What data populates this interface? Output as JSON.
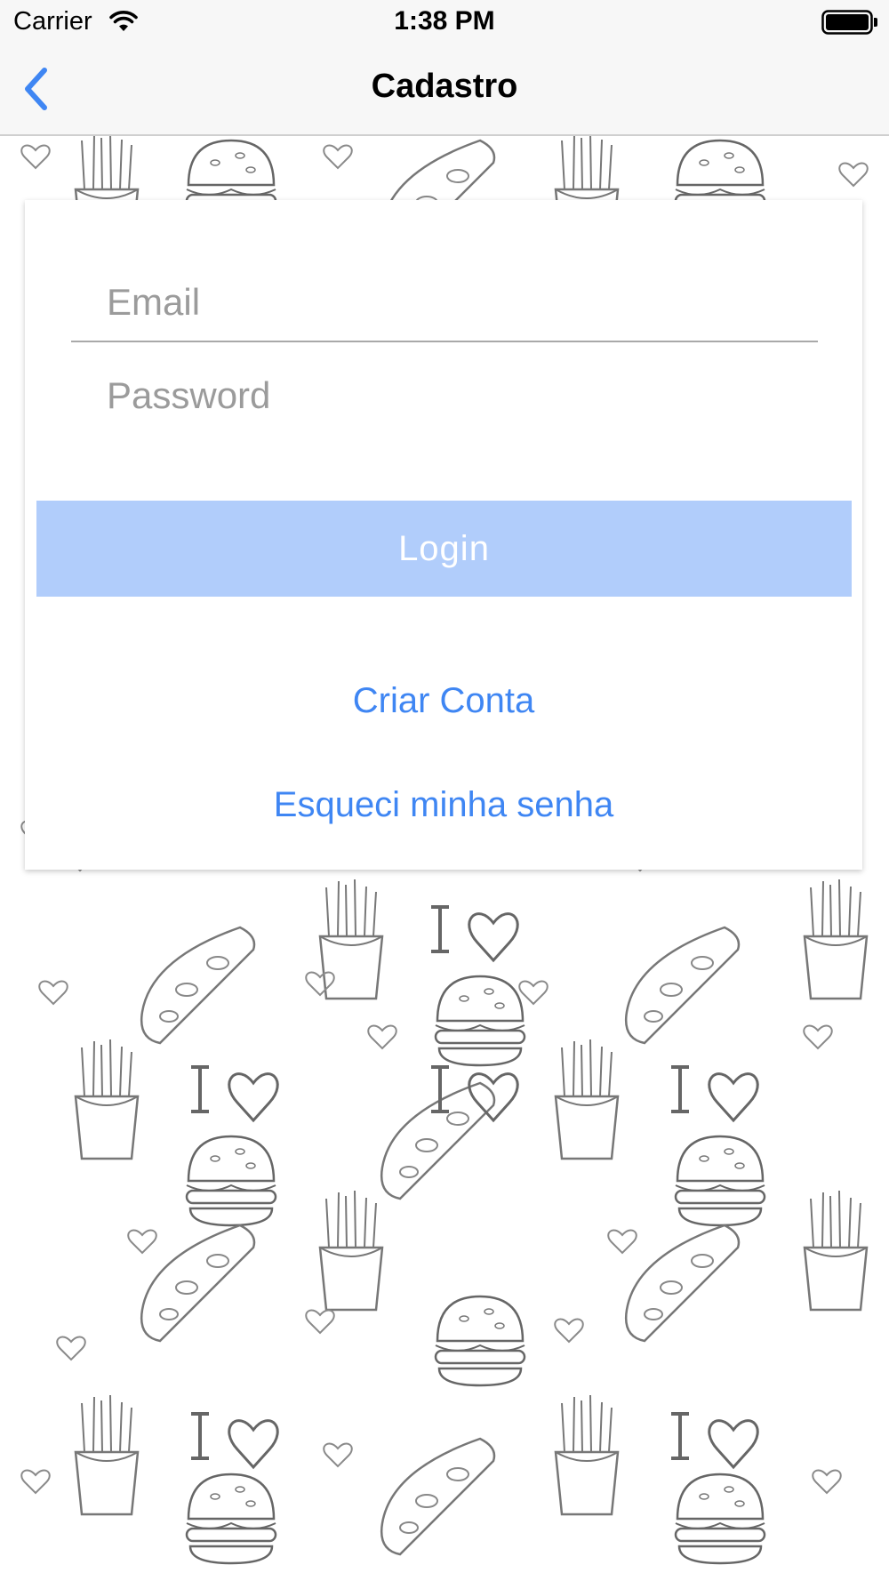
{
  "status_bar": {
    "carrier": "Carrier",
    "time": "1:38 PM",
    "wifi_icon": "wifi-icon",
    "battery_icon": "battery-icon"
  },
  "nav": {
    "title": "Cadastro",
    "back_icon": "chevron-left-icon"
  },
  "background": {
    "pattern": "food-doodle-pattern (fries, burgers, pizza, hearts, I love)"
  },
  "form": {
    "email_placeholder": "Email",
    "email_value": "",
    "password_placeholder": "Password",
    "password_value": "",
    "login_label": "Login",
    "create_account_label": "Criar Conta",
    "forgot_password_label": "Esqueci minha senha"
  },
  "colors": {
    "accent": "#3f86f3",
    "login_button": "#b1cdfb",
    "nav_background": "#f7f7f7"
  }
}
